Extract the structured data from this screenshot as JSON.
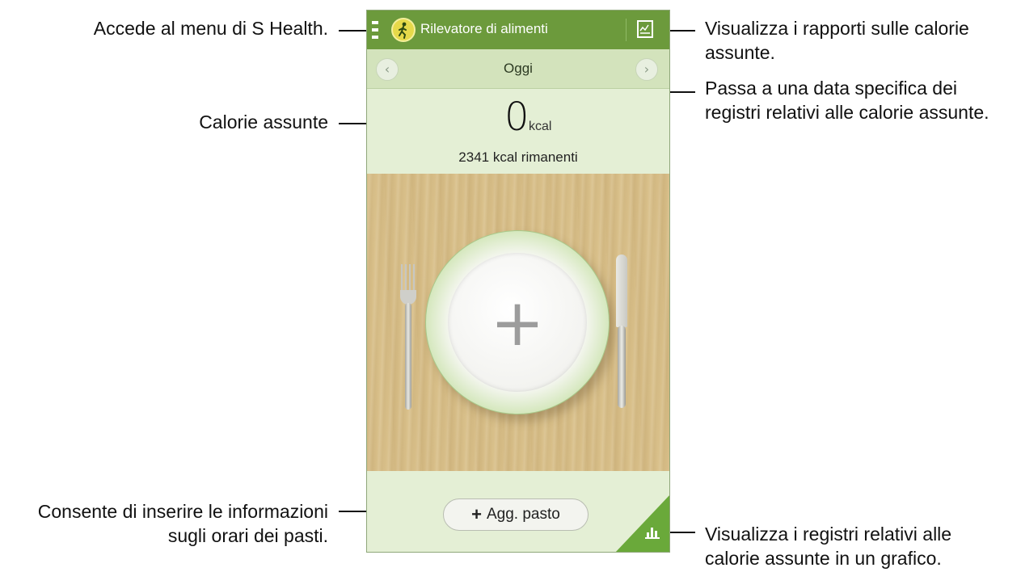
{
  "app": {
    "title": "Rilevatore di alimenti",
    "accent_color": "#6c9a3c",
    "icons": {
      "menu": "menu-icon",
      "logo": "walking-person-icon",
      "report": "report-chart-icon",
      "graph": "bar-chart-icon"
    }
  },
  "datebar": {
    "label": "Oggi",
    "prev_glyph": "‹",
    "next_glyph": "›"
  },
  "intake": {
    "value": "0",
    "unit": "kcal",
    "remaining": "2341 kcal rimanenti"
  },
  "plate": {
    "add_glyph": "+"
  },
  "actions": {
    "add_meal_plus": "+",
    "add_meal_label": "Agg. pasto"
  },
  "callouts": {
    "menu": "Accede al menu di S Health.",
    "intake": "Calorie assunte",
    "add_meal_line1": "Consente di inserire le informazioni",
    "add_meal_line2": "sugli orari dei pasti.",
    "report_line1": "Visualizza i rapporti sulle calorie",
    "report_line2": "assunte.",
    "date_line1": "Passa a una data specifica dei",
    "date_line2": "registri relativi alle calorie assunte.",
    "graph_line1": "Visualizza i registri relativi alle",
    "graph_line2": "calorie assunte in un grafico."
  }
}
